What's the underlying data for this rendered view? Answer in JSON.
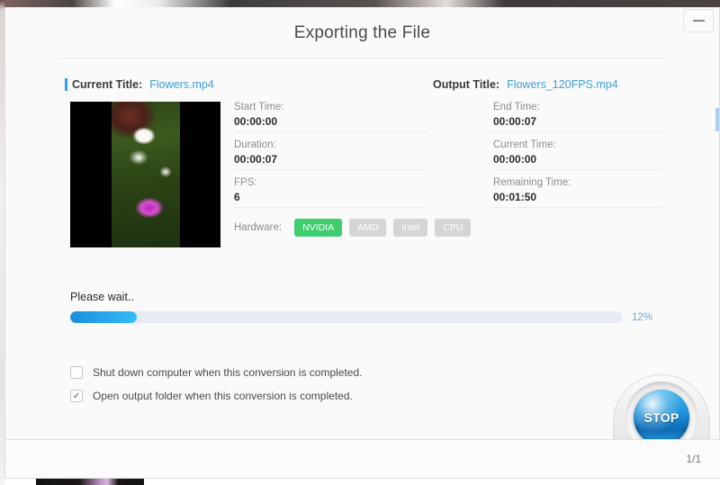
{
  "window": {
    "title": "Exporting the File",
    "minimize_icon": "minimize-icon"
  },
  "titles": {
    "current_label": "Current Title:",
    "current_value": "Flowers.mp4",
    "output_label": "Output Title:",
    "output_value": "Flowers_120FPS.mp4"
  },
  "fields": {
    "left": [
      {
        "label": "Start Time:",
        "value": "00:00:00"
      },
      {
        "label": "Duration:",
        "value": "00:00:07"
      },
      {
        "label": "FPS:",
        "value": "6"
      }
    ],
    "right": [
      {
        "label": "End Time:",
        "value": "00:00:07"
      },
      {
        "label": "Current Time:",
        "value": "00:00:00"
      },
      {
        "label": "Remaining Time:",
        "value": "00:01:50"
      }
    ]
  },
  "hardware": {
    "label": "Hardware:",
    "options": [
      {
        "name": "NVIDIA",
        "active": true
      },
      {
        "name": "AMD",
        "active": false
      },
      {
        "name": "Intel",
        "active": false
      },
      {
        "name": "CPU",
        "active": false
      }
    ],
    "active_color": "#3ece6e",
    "inactive_color": "#d5d5d5"
  },
  "progress": {
    "status_text": "Please wait..",
    "percent_label": "12%",
    "percent_value": 12,
    "fill_color": "#2aa7ec",
    "track_color": "#e8ecf2"
  },
  "options": [
    {
      "label": "Shut down computer when this conversion is completed.",
      "checked": false
    },
    {
      "label": "Open output folder when this conversion is completed.",
      "checked": true
    }
  ],
  "stop_button": {
    "label": "STOP",
    "color": "#1a8ed6"
  },
  "footer": {
    "page_count": "1/1"
  },
  "accent_color": "#29a4e8",
  "link_color": "#3f9fd8"
}
